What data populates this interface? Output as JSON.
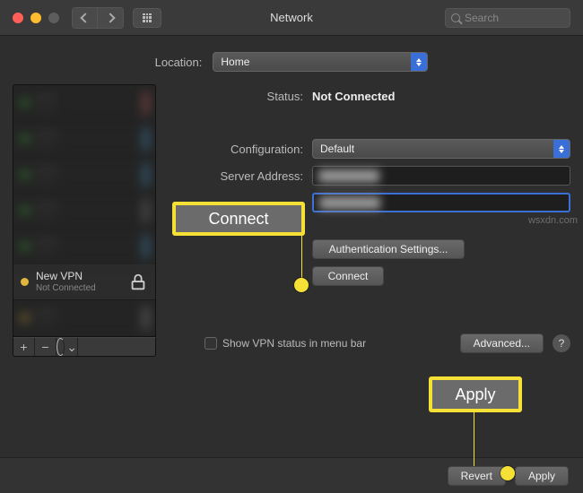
{
  "titlebar": {
    "title": "Network",
    "search_placeholder": "Search"
  },
  "location": {
    "label": "Location:",
    "value": "Home"
  },
  "sidebar": {
    "vpn": {
      "name": "New VPN",
      "status": "Not Connected"
    },
    "footer": {
      "plus": "+",
      "minus": "−",
      "gear_arrow": "⌄"
    }
  },
  "main": {
    "status_label": "Status:",
    "status_value": "Not Connected",
    "config_label": "Configuration:",
    "config_value": "Default",
    "server_label": "Server Address:",
    "server_value": "████████",
    "account_value": "████████",
    "auth_btn": "Authentication Settings...",
    "connect_btn": "Connect",
    "show_vpn": "Show VPN status in menu bar",
    "advanced_btn": "Advanced...",
    "help": "?"
  },
  "annotations": {
    "connect_callout": "Connect",
    "apply_callout": "Apply"
  },
  "footer": {
    "revert": "Revert",
    "apply": "Apply"
  },
  "watermark": "wsxdn.com"
}
